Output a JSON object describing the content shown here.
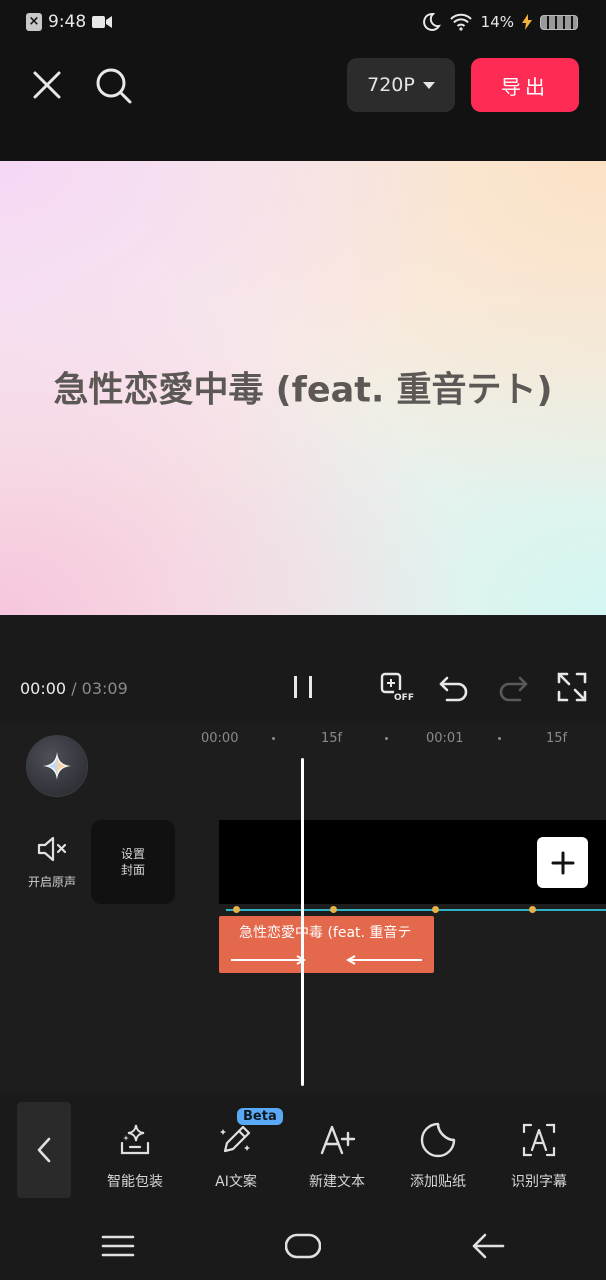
{
  "status": {
    "time": "9:48",
    "battery_percent": "14%"
  },
  "header": {
    "resolution": "720P",
    "export_label": "导出"
  },
  "preview": {
    "title": "急性恋愛中毒 (feat. 重音テト)"
  },
  "playback": {
    "current": "00:00",
    "separator": " / ",
    "total": "03:09"
  },
  "ruler": [
    "00:00",
    "15f",
    "00:01",
    "15f"
  ],
  "audio": {
    "label": "开启原声"
  },
  "cover": {
    "line1": "设置",
    "line2": "封面"
  },
  "text_clip": {
    "label": "急性恋愛中毒 (feat. 重音テ"
  },
  "toolbar": {
    "beta_badge": "Beta",
    "items": [
      {
        "label": "智能包装",
        "icon": "sparkle-package-icon"
      },
      {
        "label": "AI文案",
        "icon": "ai-pen-icon"
      },
      {
        "label": "新建文本",
        "icon": "text-add-icon"
      },
      {
        "label": "添加贴纸",
        "icon": "sticker-icon"
      },
      {
        "label": "识别字幕",
        "icon": "caption-recognize-icon"
      }
    ]
  },
  "colors": {
    "accent": "#fe2c55",
    "text_clip": "#e4684b",
    "keyline": "#2fb3c4"
  }
}
